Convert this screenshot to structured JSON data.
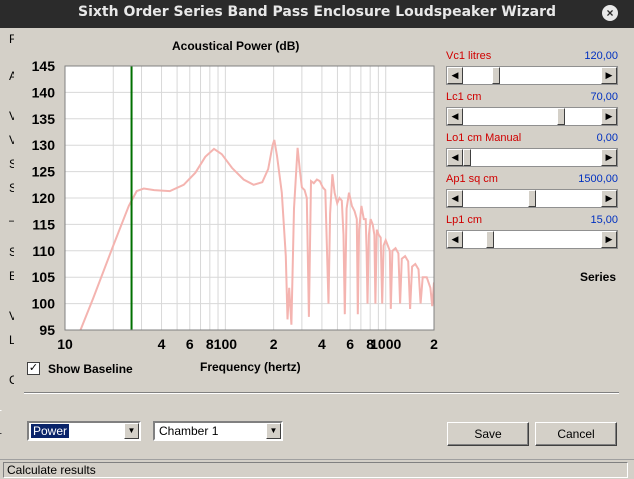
{
  "window": {
    "title": "Sixth Order Series Band Pass Enclosure Loudspeaker Wizard",
    "close_glyph": "×"
  },
  "left_edge": [
    "Fi",
    "A",
    "V",
    "V",
    "S",
    "S",
    "–",
    "S",
    "B",
    "V",
    "L",
    "C"
  ],
  "chart_data": {
    "type": "line",
    "title": "Acoustical Power (dB)",
    "xlabel": "Frequency (hertz)",
    "ylabel": "",
    "x_scale": "log",
    "xlim": [
      10,
      2000
    ],
    "ylim": [
      95,
      145
    ],
    "yticks": [
      95,
      100,
      105,
      110,
      115,
      120,
      125,
      130,
      135,
      140,
      145
    ],
    "xtick_labels": [
      {
        "x": 10,
        "label": "10"
      },
      {
        "x": 40,
        "label": "4"
      },
      {
        "x": 60,
        "label": "6"
      },
      {
        "x": 80,
        "label": "8"
      },
      {
        "x": 100,
        "label": "100"
      },
      {
        "x": 200,
        "label": "2"
      },
      {
        "x": 400,
        "label": "4"
      },
      {
        "x": 600,
        "label": "6"
      },
      {
        "x": 800,
        "label": "8"
      },
      {
        "x": 1000,
        "label": "1000"
      },
      {
        "x": 2000,
        "label": "2"
      }
    ],
    "grid": true,
    "marker_x": 26,
    "colors": {
      "curve": "#f4b4b0",
      "marker": "#007000",
      "grid": "#d8d8d8"
    },
    "series": [
      {
        "values_xy": [
          [
            12.5,
            95
          ],
          [
            15,
            101
          ],
          [
            20,
            111
          ],
          [
            25,
            118.5
          ],
          [
            28,
            121.3
          ],
          [
            31,
            121.8
          ],
          [
            36,
            121.5
          ],
          [
            45,
            121.3
          ],
          [
            55,
            122.5
          ],
          [
            65,
            124.8
          ],
          [
            75,
            127.8
          ],
          [
            85,
            129.3
          ],
          [
            95,
            128.3
          ],
          [
            110,
            125.7
          ],
          [
            130,
            123.5
          ],
          [
            150,
            122.5
          ],
          [
            170,
            123
          ],
          [
            185,
            125.5
          ],
          [
            197,
            130
          ],
          [
            202,
            131
          ],
          [
            210,
            128
          ],
          [
            225,
            121
          ],
          [
            238,
            109
          ],
          [
            244,
            97
          ],
          [
            250,
            103
          ],
          [
            258,
            96
          ],
          [
            268,
            118
          ],
          [
            282,
            129.5
          ],
          [
            292,
            125
          ],
          [
            300,
            122
          ],
          [
            312,
            121.5
          ],
          [
            322,
            120
          ],
          [
            332,
            97.5
          ],
          [
            342,
            123.2
          ],
          [
            356,
            122.8
          ],
          [
            372,
            123.5
          ],
          [
            388,
            123.2
          ],
          [
            405,
            122
          ],
          [
            420,
            121.5
          ],
          [
            432,
            108
          ],
          [
            440,
            100
          ],
          [
            450,
            117
          ],
          [
            465,
            124.5
          ],
          [
            480,
            121
          ],
          [
            498,
            119
          ],
          [
            515,
            120
          ],
          [
            532,
            119.5
          ],
          [
            545,
            113
          ],
          [
            556,
            98
          ],
          [
            570,
            118
          ],
          [
            590,
            121
          ],
          [
            615,
            118.5
          ],
          [
            640,
            117.5
          ],
          [
            660,
            116
          ],
          [
            670,
            98
          ],
          [
            682,
            114
          ],
          [
            705,
            118.5
          ],
          [
            730,
            116
          ],
          [
            750,
            116
          ],
          [
            760,
            110
          ],
          [
            770,
            100
          ],
          [
            785,
            113
          ],
          [
            805,
            116
          ],
          [
            830,
            115
          ],
          [
            850,
            113
          ],
          [
            862,
            100
          ],
          [
            880,
            114
          ],
          [
            905,
            113
          ],
          [
            930,
            112.5
          ],
          [
            950,
            100
          ],
          [
            970,
            111
          ],
          [
            1000,
            112
          ],
          [
            1030,
            111
          ],
          [
            1060,
            110
          ],
          [
            1075,
            99
          ],
          [
            1100,
            110
          ],
          [
            1150,
            110.5
          ],
          [
            1200,
            109.5
          ],
          [
            1230,
            100
          ],
          [
            1260,
            108.5
          ],
          [
            1320,
            109
          ],
          [
            1380,
            108
          ],
          [
            1420,
            99
          ],
          [
            1460,
            107
          ],
          [
            1530,
            107.5
          ],
          [
            1600,
            106.5
          ],
          [
            1650,
            100
          ],
          [
            1700,
            105
          ],
          [
            1800,
            105
          ],
          [
            1900,
            103
          ],
          [
            1950,
            99.5
          ],
          [
            2000,
            104
          ]
        ]
      }
    ]
  },
  "sliders": [
    {
      "label": "Vc1  litres",
      "value": "120,00",
      "position": 0.22
    },
    {
      "label": "Lc1  cm",
      "value": "70,00",
      "position": 0.72
    },
    {
      "label": "Lo1  cm  Manual",
      "value": "0,00",
      "position": 0.0
    },
    {
      "label": "Ap1  sq cm",
      "value": "1500,00",
      "position": 0.5
    },
    {
      "label": "Lp1  cm",
      "value": "15,00",
      "position": 0.18
    }
  ],
  "series_label": "Series",
  "baseline": {
    "label": "Show Baseline",
    "checked": "✓"
  },
  "combo_plot": {
    "value": "Power",
    "arrow": "▼"
  },
  "combo_chamber": {
    "value": "Chamber 1",
    "arrow": "▼"
  },
  "buttons": {
    "save": "Save",
    "cancel": "Cancel"
  },
  "arrows": {
    "left": "◀",
    "right": "▶"
  },
  "status": "Calculate results"
}
